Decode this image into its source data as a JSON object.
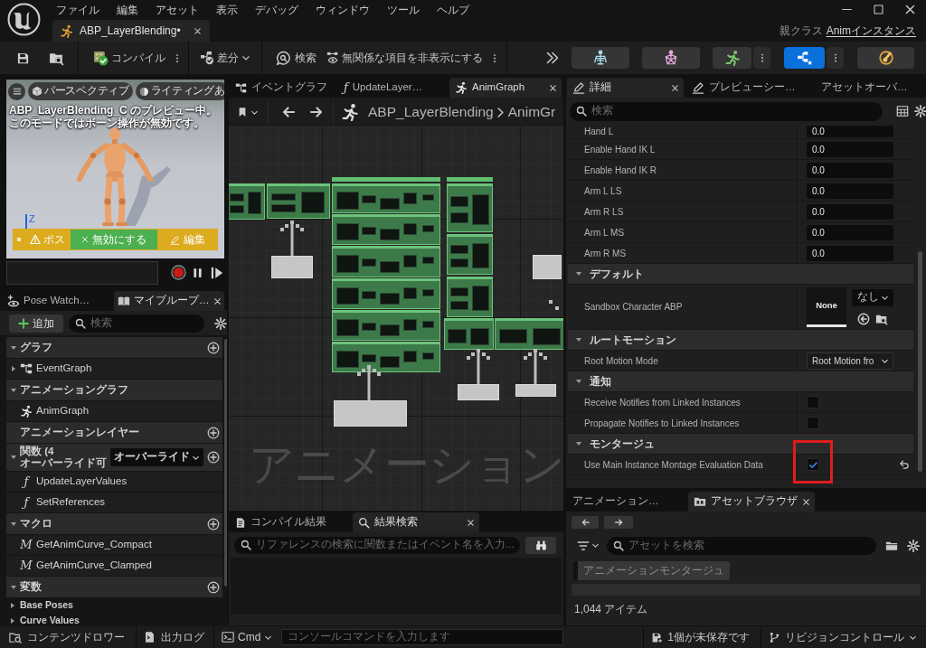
{
  "title_bar": {
    "menu": [
      "ファイル",
      "編集",
      "アセット",
      "表示",
      "デバッグ",
      "ウィンドウ",
      "ツール",
      "ヘルプ"
    ],
    "document_tabs": [
      {
        "label": "ABP_LayerBlending•",
        "selected": true
      }
    ],
    "parent_class": {
      "label": "親クラス",
      "link": "Animインスタンス"
    }
  },
  "toolbar": {
    "compile": "コンパイル",
    "diff": "差分",
    "search": "検索",
    "hide_unrelated": "無関係な項目を非表示にする",
    "modes": [
      {
        "kind": "skeleton",
        "selected": false,
        "menu": false
      },
      {
        "kind": "mesh",
        "selected": false,
        "menu": false
      },
      {
        "kind": "animation",
        "selected": false,
        "menu": true
      },
      {
        "kind": "blueprint",
        "selected": true,
        "menu": true
      },
      {
        "kind": "physics",
        "selected": false,
        "menu": false
      }
    ]
  },
  "viewport": {
    "view_buttons": [
      {
        "kind": "perspective",
        "label": "パースペクティブ"
      },
      {
        "kind": "lighting",
        "label": "ライティングあ"
      }
    ],
    "notice": [
      "ABP_LayerBlending_C のプレビュー中。",
      "このモードではボーン操作が無効です。"
    ],
    "axis_label": "Z",
    "pose_bar": {
      "warning": "ポス",
      "disable_button": "無効にする",
      "edit_button": "編集"
    }
  },
  "my_blueprint": {
    "tabs": [
      {
        "kind": "pose_watch",
        "label": "Pose Watch…",
        "selected": false
      },
      {
        "kind": "blueprint",
        "label": "マイブループ…",
        "selected": true
      }
    ],
    "add_button": "追加",
    "search": {
      "placeholder": "検索"
    },
    "tree": [
      {
        "label": "グラフ",
        "expanded": true,
        "add": true,
        "children": [
          {
            "kind": "graph",
            "label": "EventGraph",
            "expanded": false
          }
        ]
      },
      {
        "label": "アニメーショングラフ",
        "expanded": true,
        "add": false,
        "children": [
          {
            "kind": "anim",
            "label": "AnimGraph"
          }
        ]
      },
      {
        "label": "アニメーションレイヤー",
        "add": true
      },
      {
        "label": "関数 (4 オーバーライド可",
        "expanded": true,
        "add": true,
        "dropdown": "オーバーライド",
        "children": [
          {
            "kind": "function",
            "glyph": "ƒ",
            "label": "UpdateLayerValues"
          },
          {
            "kind": "function",
            "glyph": "ƒ",
            "label": "SetReferences"
          }
        ]
      },
      {
        "label": "マクロ",
        "expanded": true,
        "add": true,
        "children": [
          {
            "kind": "macro",
            "glyph": "M",
            "label": "GetAnimCurve_Compact"
          },
          {
            "kind": "macro",
            "glyph": "M",
            "label": "GetAnimCurve_Clamped"
          }
        ]
      },
      {
        "label": "変数",
        "expanded": true,
        "add": true,
        "children": [
          {
            "kind": "category",
            "label": "Base Poses",
            "expanded": false
          },
          {
            "kind": "category",
            "label": "Curve Values",
            "expanded": false
          }
        ]
      }
    ]
  },
  "graph_editor": {
    "tabs": [
      {
        "kind": "graph",
        "label": "イベントグラフ",
        "selected": false
      },
      {
        "kind": "function",
        "glyph": "ƒ",
        "label": "UpdateLayer…",
        "selected": false
      },
      {
        "kind": "anim",
        "label": "AnimGraph",
        "selected": true
      }
    ],
    "breadcrumb": [
      "ABP_LayerBlending",
      "AnimGr"
    ],
    "watermark": "アニメーション"
  },
  "compile_panel": {
    "tabs": [
      {
        "kind": "compile",
        "label": "コンパイル結果",
        "selected": false
      },
      {
        "kind": "search",
        "label": "結果検索",
        "selected": true
      }
    ],
    "search": {
      "placeholder": "リファレンスの検索に関数またはイベント名を入力..."
    }
  },
  "details": {
    "tabs": [
      {
        "kind": "details",
        "label": "詳細",
        "selected": true
      },
      {
        "kind": "details",
        "label": "プレビューシー…",
        "selected": false
      },
      {
        "kind": "plain",
        "label": "アセットオーバ…",
        "selected": false
      }
    ],
    "search": {
      "placeholder": "検索"
    },
    "rows": [
      {
        "kind": "number",
        "label": "Hand L",
        "value": "0.0"
      },
      {
        "kind": "number",
        "label": "Enable Hand IK L",
        "value": "0.0"
      },
      {
        "kind": "number",
        "label": "Enable Hand IK R",
        "value": "0.0"
      },
      {
        "kind": "number",
        "label": "Arm L LS",
        "value": "0.0"
      },
      {
        "kind": "number",
        "label": "Arm R LS",
        "value": "0.0"
      },
      {
        "kind": "number",
        "label": "Arm L MS",
        "value": "0.0"
      },
      {
        "kind": "number",
        "label": "Arm R MS",
        "value": "0.0"
      },
      {
        "kind": "section",
        "label": "デフォルト",
        "expanded": true
      },
      {
        "kind": "asset",
        "label": "Sandbox Character ABP",
        "value": "None",
        "dropdown": "なし"
      },
      {
        "kind": "section",
        "label": "ルートモーション",
        "expanded": true
      },
      {
        "kind": "dropdown",
        "label": "Root Motion Mode",
        "value": "Root Motion fro"
      },
      {
        "kind": "section",
        "label": "通知",
        "expanded": true
      },
      {
        "kind": "checkbox",
        "label": "Receive Notifies from Linked Instances",
        "checked": false,
        "highlighted": false,
        "reset_button": false
      },
      {
        "kind": "checkbox",
        "label": "Propagate Notifies to Linked Instances",
        "checked": false,
        "highlighted": false,
        "reset_button": false
      },
      {
        "kind": "section",
        "label": "モンタージュ",
        "expanded": true
      },
      {
        "kind": "checkbox",
        "label": "Use Main Instance Montage Evaluation Data",
        "checked": true,
        "highlighted": true,
        "reset_button": true
      }
    ]
  },
  "asset_panel": {
    "tabs": [
      {
        "kind": "plain",
        "label": "アニメーション…",
        "selected": false
      },
      {
        "kind": "asset_browser",
        "label": "アセットブラウザ",
        "selected": true
      }
    ],
    "search": {
      "placeholder": "アセットを検索"
    },
    "filter_chip": "アニメーションモンタージュ",
    "item_count": "1,044 アイテム"
  },
  "status_bar": {
    "content_drawer": "コンテンツドロワー",
    "output_log": "出力ログ",
    "cmd": "Cmd",
    "console": {
      "placeholder": "コンソールコマンドを入力します"
    },
    "unsaved": "1個が未保存です",
    "source_control": "リビジョンコントロール"
  }
}
